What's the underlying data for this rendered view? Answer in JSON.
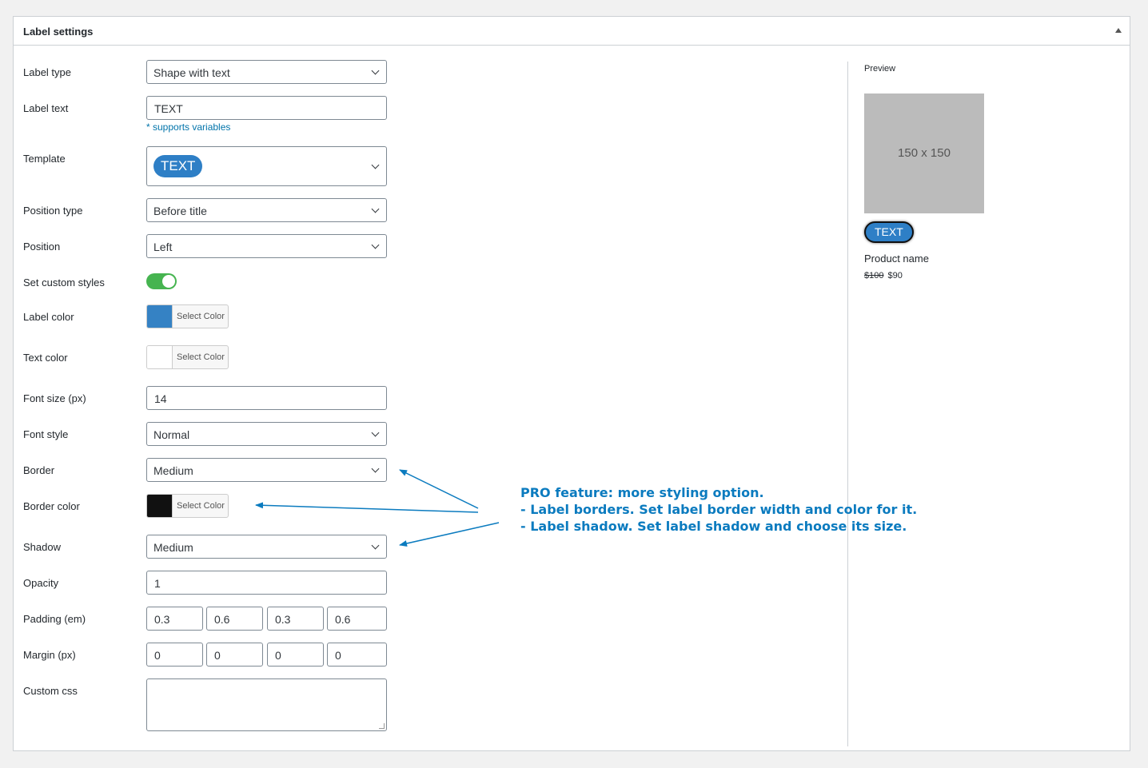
{
  "panel": {
    "title": "Label settings"
  },
  "form": {
    "label_type": {
      "label": "Label type",
      "value": "Shape with text"
    },
    "label_text": {
      "label": "Label text",
      "value": "TEXT",
      "hint": "* supports variables"
    },
    "template": {
      "label": "Template",
      "value": "TEXT"
    },
    "position_type": {
      "label": "Position type",
      "value": "Before title"
    },
    "position": {
      "label": "Position",
      "value": "Left"
    },
    "custom_styles": {
      "label": "Set custom styles",
      "enabled": true
    },
    "label_color": {
      "label": "Label color",
      "button": "Select Color",
      "color": "#3582c4"
    },
    "text_color": {
      "label": "Text color",
      "button": "Select Color",
      "color": "#ffffff"
    },
    "font_size": {
      "label": "Font size (px)",
      "value": "14"
    },
    "font_style": {
      "label": "Font style",
      "value": "Normal"
    },
    "border": {
      "label": "Border",
      "value": "Medium"
    },
    "border_color": {
      "label": "Border color",
      "button": "Select Color",
      "color": "#111111"
    },
    "shadow": {
      "label": "Shadow",
      "value": "Medium"
    },
    "opacity": {
      "label": "Opacity",
      "value": "1"
    },
    "padding": {
      "label": "Padding (em)",
      "values": [
        "0.3",
        "0.6",
        "0.3",
        "0.6"
      ]
    },
    "margin": {
      "label": "Margin (px)",
      "values": [
        "0",
        "0",
        "0",
        "0"
      ]
    },
    "custom_css": {
      "label": "Custom css",
      "value": ""
    }
  },
  "preview": {
    "title": "Preview",
    "image_text": "150 x 150",
    "label_text": "TEXT",
    "product_name": "Product name",
    "old_price": "$100",
    "new_price": "$90"
  },
  "annotation": {
    "line1": "PRO feature: more styling option.",
    "line2": "- Label borders. Set label border width and color for it.",
    "line3": "- Label shadow. Set label shadow and choose its size.",
    "color": "#0b7bbf"
  }
}
